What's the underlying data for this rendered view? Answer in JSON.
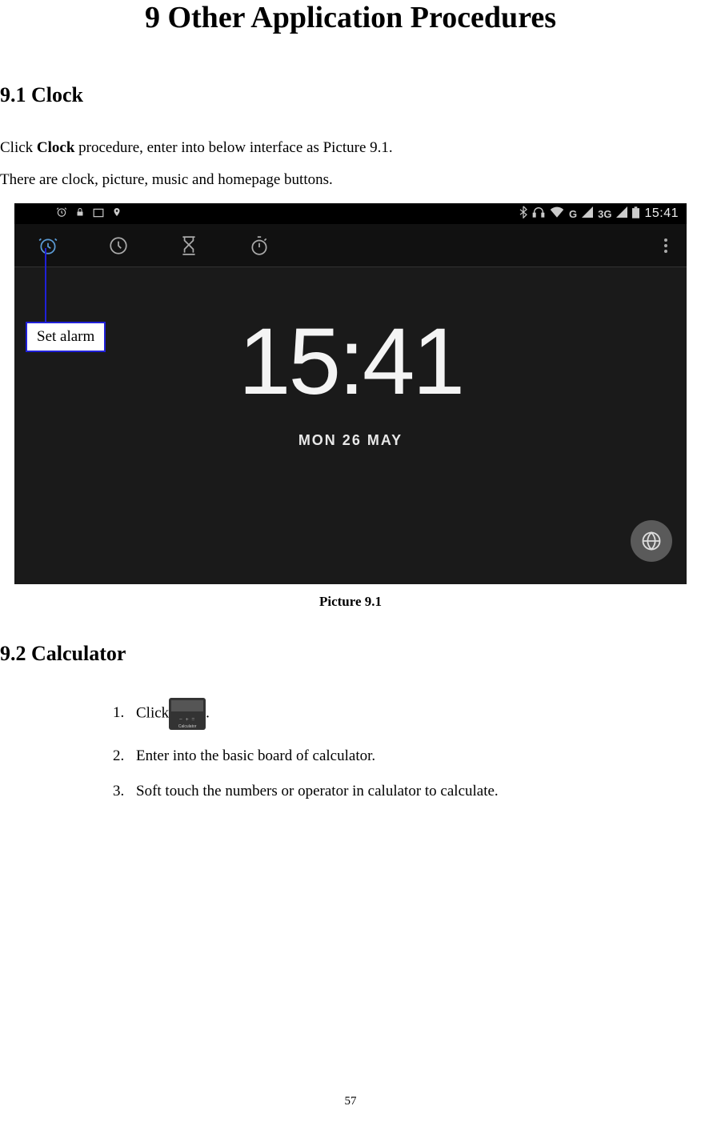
{
  "page": {
    "title": "9 Other Application Procedures",
    "number": "57"
  },
  "sections": {
    "clock": {
      "heading": "9.1 Clock",
      "para1_pre": "Click ",
      "para1_bold": "Clock",
      "para1_post": " procedure, enter into below interface as Picture 9.1.",
      "para2": "There are clock, picture, music and homepage buttons.",
      "caption": "Picture 9.1",
      "callout": "Set alarm"
    },
    "calculator": {
      "heading": "9.2 Calculator",
      "items": {
        "i1_pre": "Click",
        "i1_post": ".",
        "i2": "Enter into the basic board of calculator.",
        "i3": "Soft touch the numbers or operator in calulator to calculate."
      }
    }
  },
  "screenshot": {
    "status_time": "15:41",
    "status_3g": "3G",
    "status_g": "G",
    "big_time": "15:41",
    "date": "MON 26 MAY"
  }
}
